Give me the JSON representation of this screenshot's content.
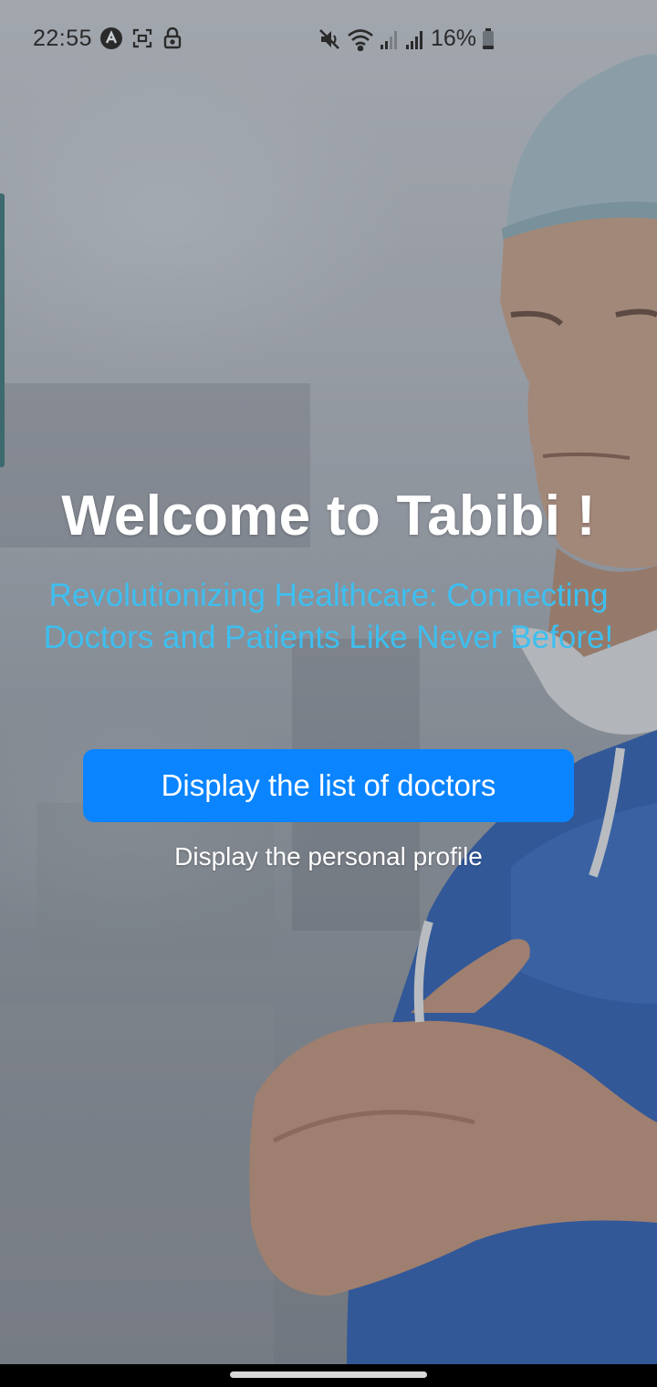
{
  "status_bar": {
    "time": "22:55",
    "battery": "16%",
    "icons": [
      "app-notification-icon",
      "screenshot-icon",
      "lock-icon",
      "mute-icon",
      "wifi-icon",
      "signal-icon",
      "signal-icon",
      "battery-icon"
    ]
  },
  "hero": {
    "title": "Welcome to Tabibi !",
    "subtitle": "Revolutionizing Healthcare: Connecting Doctors and Patients Like Never Before!"
  },
  "actions": {
    "primary_label": "Display the list of doctors",
    "secondary_label": "Display the personal profile"
  },
  "colors": {
    "primary_button": "#0a84ff",
    "subtitle": "#3dbff0",
    "title": "#ffffff"
  }
}
